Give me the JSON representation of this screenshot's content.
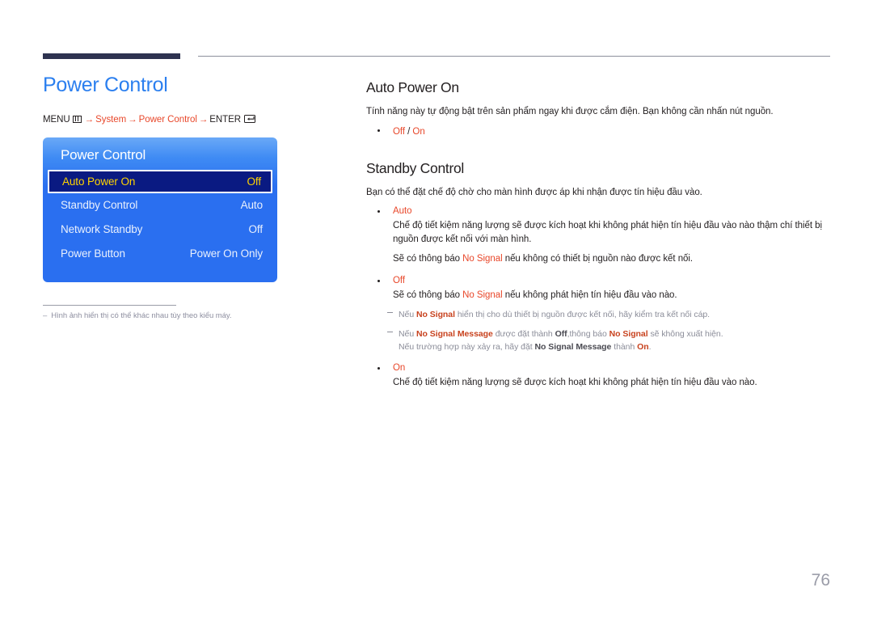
{
  "header": {
    "rule_color": "#2e3350"
  },
  "left": {
    "title": "Power Control",
    "breadcrumb": {
      "menu_label": "MENU",
      "menu_icon": "menu-bars-icon",
      "arrow": "→",
      "path_1": "System",
      "path_2": "Power Control",
      "enter_label": "ENTER",
      "enter_icon": "enter-key-icon"
    },
    "osd": {
      "title": "Power Control",
      "rows": [
        {
          "label": "Auto Power On",
          "value": "Off",
          "selected": true
        },
        {
          "label": "Standby Control",
          "value": "Auto",
          "selected": false
        },
        {
          "label": "Network Standby",
          "value": "Off",
          "selected": false
        },
        {
          "label": "Power Button",
          "value": "Power On Only",
          "selected": false
        }
      ],
      "accent_bg": "#2a6ff0",
      "selected_bg": "#0a1a82",
      "selected_text": "#ffd400"
    },
    "footnote": {
      "dash": "–",
      "text": "Hình ảnh hiển thị có thể khác nhau tùy theo kiểu máy."
    }
  },
  "right": {
    "section_1": {
      "heading": "Auto Power On",
      "intro": "Tính năng này tự động bật trên sản phẩm ngay khi được cắm điện. Bạn không cần nhấn nút nguồn.",
      "option_off": "Off",
      "option_sep": " / ",
      "option_on": "On"
    },
    "section_2": {
      "heading": "Standby Control",
      "intro": "Bạn có thể đặt chế độ chờ cho màn hình được áp khi nhận được tín hiệu đầu vào.",
      "bullet_auto": {
        "label": "Auto",
        "body_1": "Chế độ tiết kiệm năng lượng sẽ được kích hoạt khi không phát hiện tín hiệu đầu vào nào thậm chí thiết bị nguồn được kết nối với màn hình.",
        "body_2_pre": "Sẽ có thông báo ",
        "body_2_hl": "No Signal",
        "body_2_post": " nếu không có thiết bị nguồn nào được kết nối."
      },
      "bullet_off": {
        "label": "Off",
        "body_pre": "Sẽ có thông báo ",
        "body_hl": "No Signal",
        "body_post": " nếu không phát hiện tín hiệu đầu vào nào."
      },
      "note_1": {
        "p1": "Nếu ",
        "hl1": "No Signal",
        "p2": " hiển thị cho dù thiết bị nguồn được kết nối, hãy kiểm tra kết nối cáp."
      },
      "note_2": {
        "p1": "Nếu ",
        "hl1": "No Signal Message",
        "p2": " được đặt thành ",
        "hl2": "Off",
        "p3": ",thông báo ",
        "hl3": "No Signal",
        "p4": " sẽ không xuất hiện.",
        "line2_p1": "Nếu trường hợp này xảy ra, hãy đặt ",
        "line2_hl1": "No Signal Message",
        "line2_p2": " thành ",
        "line2_hl2": "On",
        "line2_p3": "."
      },
      "bullet_on": {
        "label": "On",
        "body": "Chế độ tiết kiệm năng lượng sẽ được kích hoạt khi không phát hiện tín hiệu đầu vào nào."
      }
    }
  },
  "page_number": "76"
}
